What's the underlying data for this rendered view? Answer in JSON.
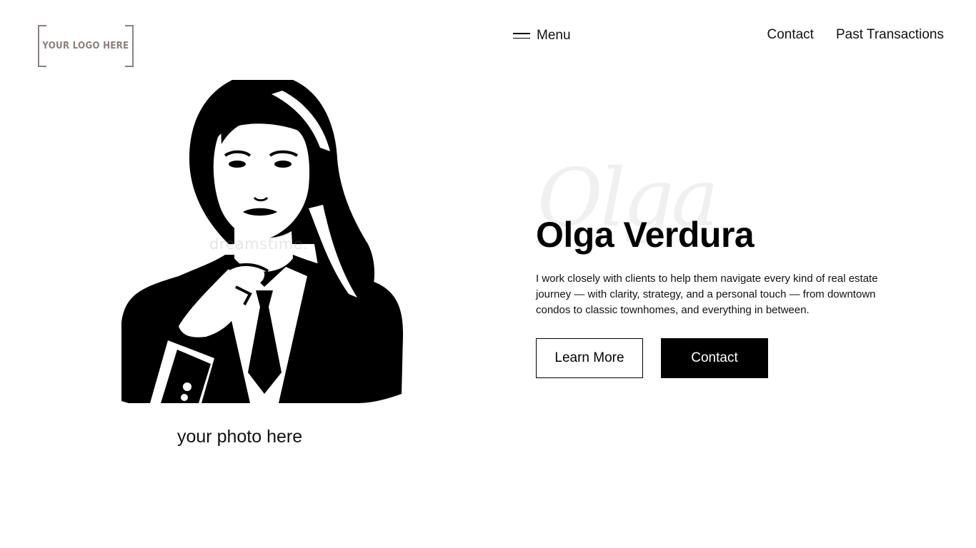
{
  "header": {
    "logo_text": "YOUR LOGO HERE",
    "menu_label": "Menu",
    "nav": [
      {
        "label": "Contact"
      },
      {
        "label": "Past Transactions"
      }
    ]
  },
  "portrait": {
    "watermark": "dreamstime.",
    "caption": "your photo here"
  },
  "hero": {
    "script_name": "Olga",
    "name": "Olga Verdura",
    "description": "I work closely with clients to help them navigate every kind of real estate journey — with clarity, strategy, and a personal touch — from downtown condos to classic townhomes, and everything in between.",
    "primary_button": "Learn More",
    "secondary_button": "Contact"
  },
  "colors": {
    "background": "#ffffff",
    "text": "#000000",
    "logo": "#8c7f80",
    "button_solid": "#000000"
  }
}
